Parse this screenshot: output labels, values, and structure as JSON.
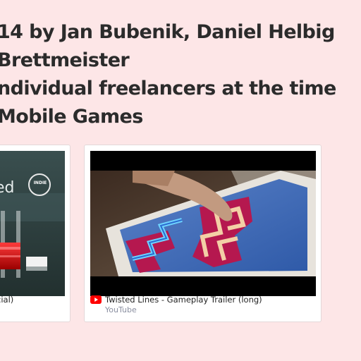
{
  "headline": {
    "line1": "14 by Jan Bubenik, Daniel Helbig",
    "line2": "Brettmeister",
    "line3": "ndividual freelancers at the time",
    "line4": "Mobile Games"
  },
  "cards": [
    {
      "title": "cial)",
      "thumb_text": "ed",
      "badge": "INDIE"
    },
    {
      "title": "Twisted Lines - Gameplay Trailer (long)",
      "source": "YouTube",
      "icon": "youtube-icon"
    }
  ],
  "colors": {
    "background": "#fde6e7",
    "youtube_red": "#ff0000",
    "source_text": "#8a8fa0"
  }
}
